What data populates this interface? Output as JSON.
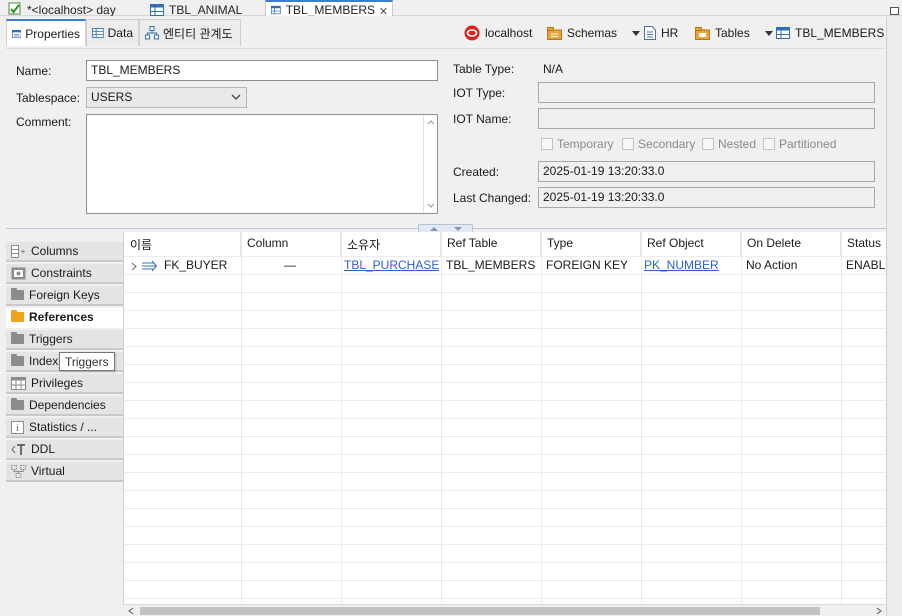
{
  "editor_tabs": [
    {
      "label": "*<localhost> day"
    },
    {
      "label": "TBL_ANIMAL"
    },
    {
      "label": "TBL_MEMBERS",
      "active": true
    }
  ],
  "sub_tabs": [
    {
      "label": "Properties",
      "active": true
    },
    {
      "label": "Data"
    },
    {
      "label": "엔티티 관계도"
    }
  ],
  "breadcrumb": {
    "connection": "localhost",
    "schemas": "Schemas",
    "schema": "HR",
    "tables": "Tables",
    "table": "TBL_MEMBERS"
  },
  "form": {
    "name_label": "Name:",
    "name_value": "TBL_MEMBERS",
    "tablespace_label": "Tablespace:",
    "tablespace_value": "USERS",
    "comment_label": "Comment:",
    "comment_value": "",
    "table_type_label": "Table Type:",
    "table_type_value": "N/A",
    "iot_type_label": "IOT Type:",
    "iot_type_value": "",
    "iot_name_label": "IOT Name:",
    "iot_name_value": "",
    "checkboxes": [
      "Temporary",
      "Secondary",
      "Nested",
      "Partitioned"
    ],
    "created_label": "Created:",
    "created_value": "2025-01-19 13:20:33.0",
    "last_changed_label": "Last Changed:",
    "last_changed_value": "2025-01-19 13:20:33.0"
  },
  "side_nav": [
    {
      "label": "Columns",
      "icon": "columns-icon"
    },
    {
      "label": "Constraints",
      "icon": "constraints-icon"
    },
    {
      "label": "Foreign Keys",
      "icon": "folder-icon"
    },
    {
      "label": "References",
      "icon": "folder-icon",
      "active": true
    },
    {
      "label": "Triggers",
      "icon": "folder-icon"
    },
    {
      "label": "Indexes",
      "icon": "folder-icon"
    },
    {
      "label": "Privileges",
      "icon": "privileges-icon"
    },
    {
      "label": "Dependencies",
      "icon": "folder-icon"
    },
    {
      "label": "Statistics / ...",
      "icon": "info-icon"
    },
    {
      "label": "DDL",
      "icon": "ddl-icon"
    },
    {
      "label": "Virtual",
      "icon": "virtual-icon"
    }
  ],
  "tooltip": "Triggers",
  "grid": {
    "columns": [
      "이름",
      "Column",
      "소유자",
      "Ref Table",
      "Type",
      "Ref Object",
      "On Delete",
      "Status"
    ],
    "rows": [
      {
        "name": "FK_BUYER",
        "column": "—",
        "owner": "TBL_PURCHASE",
        "ref_table": "TBL_MEMBERS",
        "type": "FOREIGN KEY",
        "ref_object": "PK_NUMBER",
        "on_delete": "No Action",
        "status": "ENABLED"
      }
    ]
  },
  "colors": {
    "accent": "#3c7ecf",
    "link": "#2a63c9",
    "folder_active": "#f0a31c"
  }
}
